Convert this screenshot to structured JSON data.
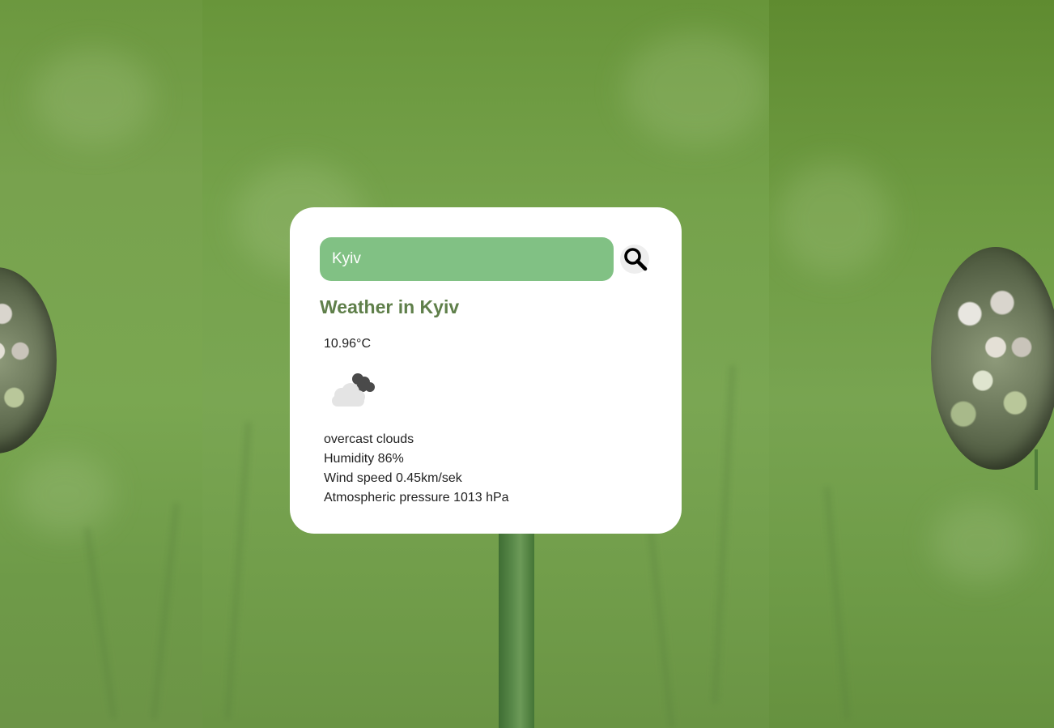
{
  "search": {
    "value": "Kyiv",
    "placeholder": "Search"
  },
  "weather": {
    "title": "Weather in Kyiv",
    "temperature": "10.96°C",
    "icon": "overcast-clouds-icon",
    "description": "overcast clouds",
    "humidity": "Humidity 86%",
    "wind": "Wind speed 0.45km/sek",
    "pressure": "Atmospheric pressure 1013 hPa"
  },
  "colors": {
    "accent": "#81c184",
    "title": "#5f7f4a",
    "card": "#ffffff",
    "background": "#74a04a"
  }
}
